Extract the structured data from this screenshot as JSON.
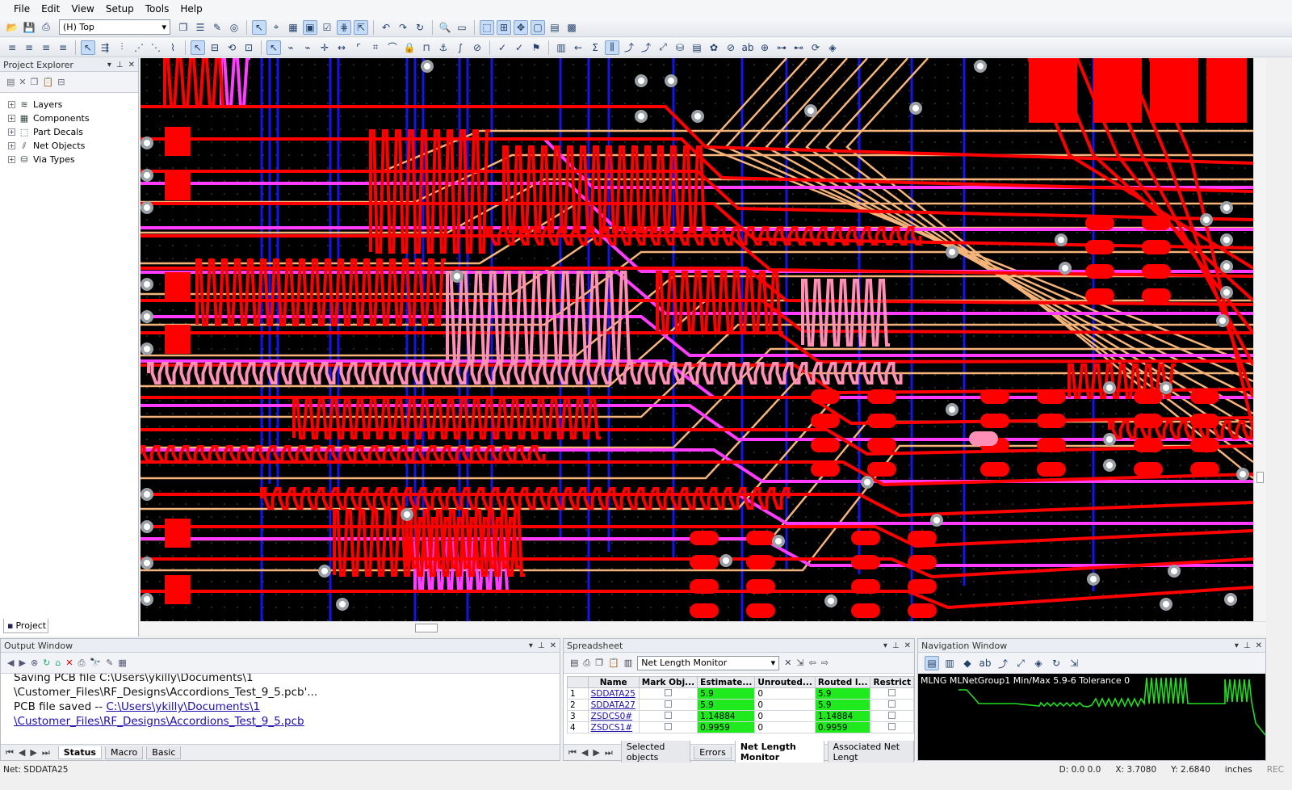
{
  "menu": [
    "File",
    "Edit",
    "View",
    "Setup",
    "Tools",
    "Help"
  ],
  "toolbar": {
    "layer_select": "(H) Top"
  },
  "explorer": {
    "title": "Project Explorer",
    "items": [
      {
        "label": "Layers",
        "icon": "layers-icon"
      },
      {
        "label": "Components",
        "icon": "components-icon"
      },
      {
        "label": "Part Decals",
        "icon": "part-decals-icon"
      },
      {
        "label": "Net Objects",
        "icon": "net-objects-icon"
      },
      {
        "label": "Via Types",
        "icon": "via-types-icon"
      }
    ],
    "tab": "Project"
  },
  "output": {
    "title": "Output Window",
    "lines": {
      "l1": "Saving PCB file  C:\\Users\\ykilly\\Documents\\1",
      "l2": "\\Customer_Files\\RF_Designs\\Accordions_Test_9_5.pcb'...",
      "l3a": "PCB file saved -- ",
      "l3b": "C:\\Users\\ykilly\\Documents\\1",
      "l4": "\\Customer_Files\\RF_Designs\\Accordions_Test_9_5.pcb"
    },
    "tabs": [
      "Status",
      "Macro",
      "Basic"
    ]
  },
  "spreadsheet": {
    "title": "Spreadsheet",
    "view": "Net Length Monitor",
    "columns": [
      "",
      "Name",
      "Mark Obj...",
      "Estimate...",
      "Unrouted...",
      "Routed l...",
      "Restrict"
    ],
    "rows": [
      {
        "n": "1",
        "name": "SDDATA25",
        "est": "5.9",
        "unr": "0",
        "routed": "5.9"
      },
      {
        "n": "2",
        "name": "SDDATA27",
        "est": "5.9",
        "unr": "0",
        "routed": "5.9"
      },
      {
        "n": "3",
        "name": "ZSDCS0#",
        "est": "1.14884",
        "unr": "0",
        "routed": "1.14884"
      },
      {
        "n": "4",
        "name": "ZSDCS1#",
        "est": "0.9959",
        "unr": "0",
        "routed": "0.9959"
      }
    ],
    "tabs": [
      "Selected objects",
      "Errors",
      "Net Length Monitor",
      "Associated Net Lengt"
    ]
  },
  "navigation": {
    "title": "Navigation Window",
    "info": "MLNG MLNetGroup1 Min/Max 5.9-6 Tolerance 0"
  },
  "status": {
    "net": "Net: SDDATA25",
    "d": "D: 0.0 0.0",
    "x": "X: 3.7080",
    "y": "Y: 2.6840",
    "units": "inches",
    "rec": "REC"
  },
  "colors": {
    "trace_red": "#ff0000",
    "trace_magenta": "#ff3cff",
    "trace_orange": "#f5b47a",
    "trace_pink": "#ff8fb4",
    "trace_blue": "#1515e8",
    "background": "#000000"
  }
}
